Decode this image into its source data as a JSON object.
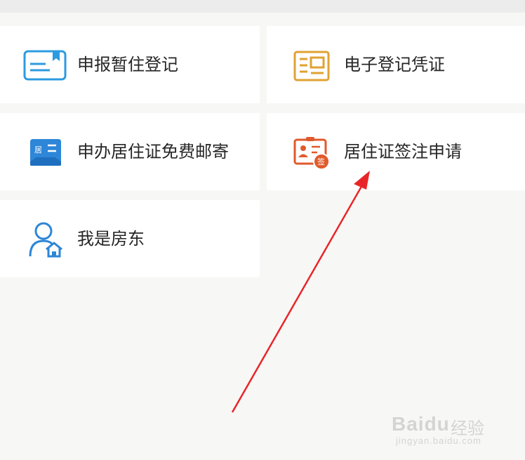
{
  "tiles": [
    {
      "label": "申报暂住登记",
      "icon": "envelope-bookmark-icon",
      "color": "#2d9be0"
    },
    {
      "label": "电子登记凭证",
      "icon": "certificate-icon",
      "color": "#e0a233"
    },
    {
      "label": "申办居住证免费邮寄",
      "icon": "residence-card-mail-icon",
      "color": "#2d86d8"
    },
    {
      "label": "居住证签注申请",
      "icon": "id-card-sign-icon",
      "color": "#e05a2b"
    },
    {
      "label": "我是房东",
      "icon": "landlord-icon",
      "color": "#2d86d8"
    }
  ],
  "icon_text": {
    "residence": "居",
    "sign": "签"
  },
  "annotation": {
    "arrow_color": "#e8262a"
  },
  "watermark": {
    "logo": "Bai",
    "logo_paw": "du",
    "brand": "经验",
    "url": "jingyan.baidu.com"
  }
}
